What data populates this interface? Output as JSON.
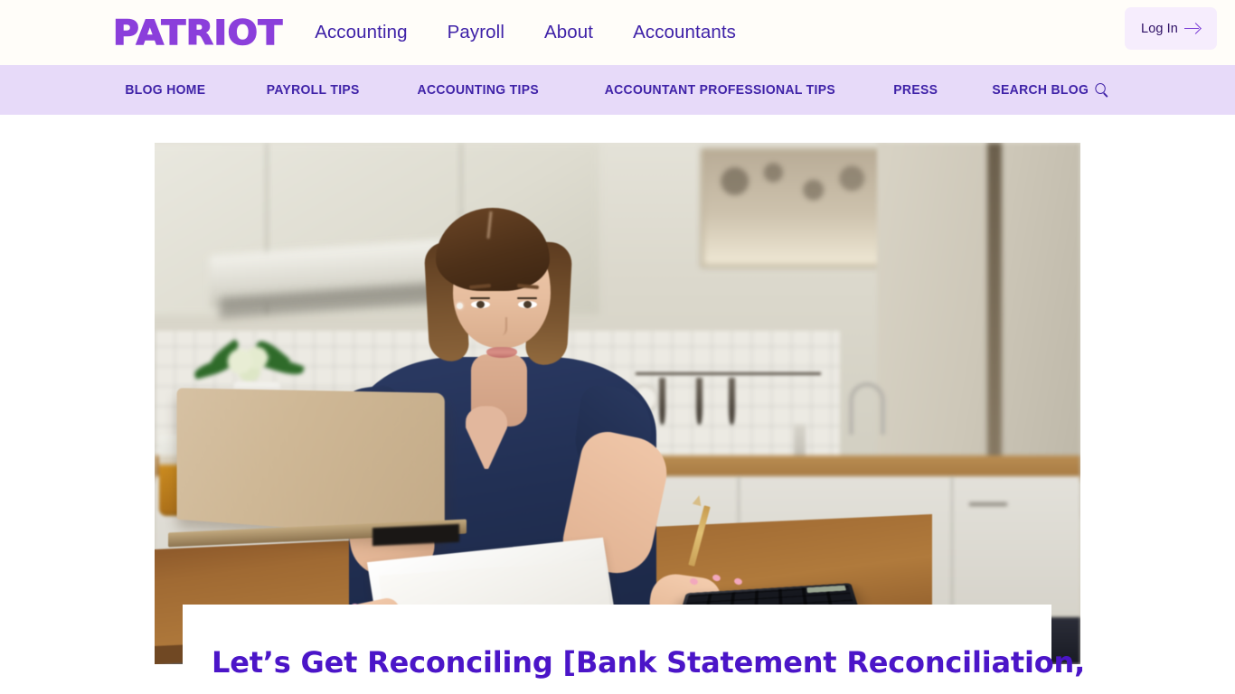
{
  "header": {
    "logo_text": "PATRIOT",
    "nav": [
      {
        "label": "Accounting"
      },
      {
        "label": "Payroll"
      },
      {
        "label": "About"
      },
      {
        "label": "Accountants"
      }
    ],
    "login": {
      "label": "Log In",
      "icon": "arrow-right-icon"
    }
  },
  "sub_nav": {
    "items": [
      {
        "label": "BLOG HOME"
      },
      {
        "label": "PAYROLL TIPS"
      },
      {
        "label": "ACCOUNTING TIPS"
      },
      {
        "label": "ACCOUNTANT PROFESSIONAL TIPS"
      },
      {
        "label": "PRESS"
      },
      {
        "label": "SEARCH BLOG",
        "icon": "search-icon"
      }
    ]
  },
  "hero": {
    "image_alt": "Woman in navy blouse reviewing a paper statement at a kitchen table with a laptop and calculator"
  },
  "article": {
    "title": "Let’s Get Reconciling [Bank Statement Reconciliation,"
  },
  "colors": {
    "brand_purple": "#8b3fdb",
    "nav_text": "#3f22a8",
    "subnav_bg": "#e7daf9",
    "header_bg": "#fffdf9",
    "title_purple": "#4b15c8",
    "login_bg": "#f6edfd"
  }
}
